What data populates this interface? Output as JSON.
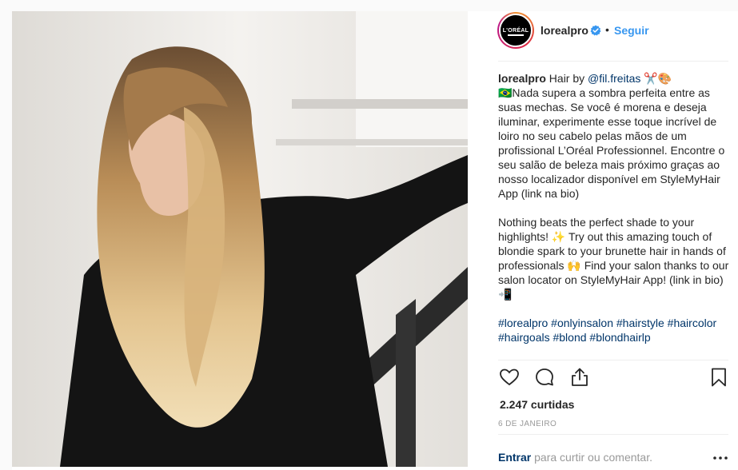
{
  "header": {
    "username": "lorealpro",
    "separator": "•",
    "follow_label": "Seguir",
    "avatar_text": "L'ORÉAL"
  },
  "caption": {
    "username": "lorealpro",
    "intro": "Hair by",
    "mention": "@fil.freitas",
    "emoji_1": "✂️🎨",
    "paragraph_pt": "🇧🇷Nada supera a sombra perfeita entre as suas mechas. Se você é morena e deseja iluminar, experimente esse toque incrível de loiro no seu cabelo pelas mãos de um profissional L’Oréal Professionnel. Encontre o seu salão de beleza mais próximo graças ao nosso localizador disponível em StyleMyHair App (link na bio)",
    "paragraph_en": "Nothing beats the perfect shade to your highlights! ✨ Try out this amazing touch of blondie spark to your brunette hair in hands of professionals 🙌 Find your salon thanks to our salon locator on StyleMyHair App! (link in bio) 📲",
    "hashtags": "#lorealpro #onlyinsalon #hairstyle #haircolor #hairgoals #blond #blondhairlp"
  },
  "stats": {
    "likes": "2.247 curtidas",
    "date": "6 de janeiro"
  },
  "comment": {
    "login_label": "Entrar",
    "prompt": "para curtir ou comentar."
  },
  "icons": [
    "heart-icon",
    "comment-icon",
    "share-icon",
    "bookmark-icon",
    "verified-icon",
    "more-icon"
  ],
  "colors": {
    "link_blue": "#3897f0",
    "text": "#262626",
    "muted": "#999999",
    "mention": "#003569"
  }
}
